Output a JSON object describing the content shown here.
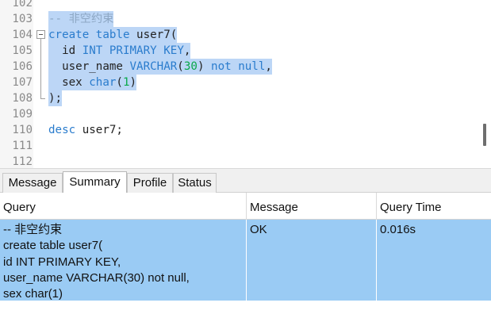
{
  "editor": {
    "lines": [
      {
        "num": "102",
        "selected": false,
        "tokens": []
      },
      {
        "num": "103",
        "selected": true,
        "tokens": [
          {
            "t": "-- 非空约束",
            "c": "cmt"
          }
        ]
      },
      {
        "num": "104",
        "selected": true,
        "tokens": [
          {
            "t": "create",
            "c": "kw"
          },
          {
            "t": " "
          },
          {
            "t": "table",
            "c": "kw"
          },
          {
            "t": " user7("
          }
        ]
      },
      {
        "num": "105",
        "selected": true,
        "tokens": [
          {
            "t": "  id "
          },
          {
            "t": "INT",
            "c": "kw"
          },
          {
            "t": " "
          },
          {
            "t": "PRIMARY",
            "c": "kw"
          },
          {
            "t": " "
          },
          {
            "t": "KEY",
            "c": "kw"
          },
          {
            "t": ","
          }
        ]
      },
      {
        "num": "106",
        "selected": true,
        "tokens": [
          {
            "t": "  user_name "
          },
          {
            "t": "VARCHAR",
            "c": "kw"
          },
          {
            "t": "("
          },
          {
            "t": "30",
            "c": "num"
          },
          {
            "t": ") "
          },
          {
            "t": "not",
            "c": "kw"
          },
          {
            "t": " "
          },
          {
            "t": "null",
            "c": "kw"
          },
          {
            "t": ","
          }
        ]
      },
      {
        "num": "107",
        "selected": true,
        "tokens": [
          {
            "t": "  sex "
          },
          {
            "t": "char",
            "c": "kw"
          },
          {
            "t": "("
          },
          {
            "t": "1",
            "c": "num"
          },
          {
            "t": ")"
          }
        ]
      },
      {
        "num": "108",
        "selected": true,
        "tokens": [
          {
            "t": ");"
          }
        ]
      },
      {
        "num": "109",
        "selected": false,
        "tokens": []
      },
      {
        "num": "110",
        "selected": false,
        "tokens": [
          {
            "t": "desc",
            "c": "kw"
          },
          {
            "t": " user7;"
          }
        ]
      },
      {
        "num": "111",
        "selected": false,
        "tokens": []
      },
      {
        "num": "112",
        "selected": false,
        "tokens": []
      }
    ]
  },
  "tabs": [
    {
      "label": "Message",
      "active": false
    },
    {
      "label": "Summary",
      "active": true
    },
    {
      "label": "Profile",
      "active": false
    },
    {
      "label": "Status",
      "active": false
    }
  ],
  "results": {
    "headers": [
      "Query",
      "Message",
      "Query Time"
    ],
    "rows": [
      {
        "query": [
          "-- 非空约束",
          "create table user7(",
          "id INT PRIMARY KEY,",
          "user_name VARCHAR(30) not null,",
          "sex char(1)"
        ],
        "message": "OK",
        "query_time": "0.016s"
      }
    ]
  },
  "colors": {
    "selection": "#bcd6f6",
    "keyword": "#2a7ccd",
    "number": "#0aa84a",
    "comment": "#8da7c4",
    "row_selected": "#9acbf4"
  }
}
